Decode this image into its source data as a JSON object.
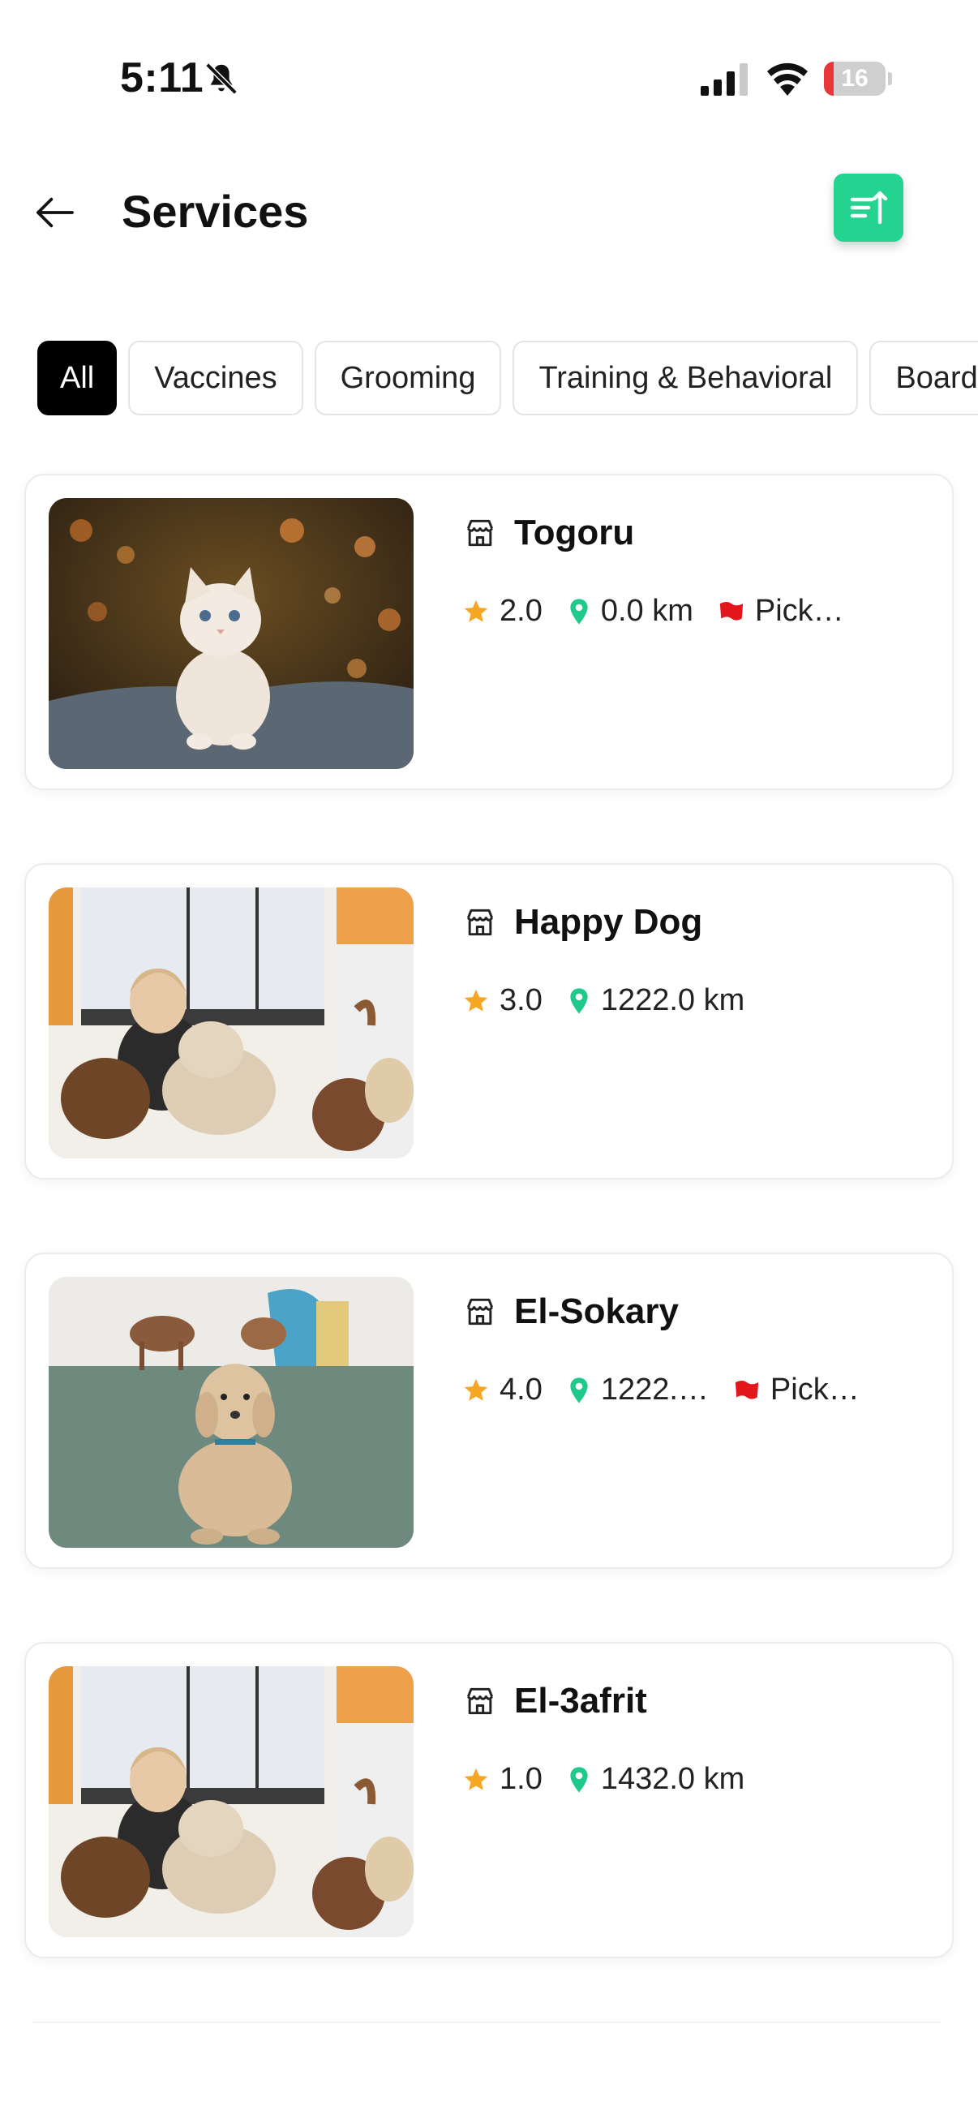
{
  "status_bar": {
    "time": "5:11",
    "battery": "16",
    "battery_level": 0.16
  },
  "header": {
    "title": "Services"
  },
  "filters": [
    {
      "label": "All",
      "active": true
    },
    {
      "label": "Vaccines",
      "active": false
    },
    {
      "label": "Grooming",
      "active": false
    },
    {
      "label": "Training & Behavioral",
      "active": false
    },
    {
      "label": "Boarding",
      "active": false
    }
  ],
  "services": [
    {
      "name": "Togoru",
      "rating": "2.0",
      "distance": "0.0 km",
      "tag": "Pick…",
      "image": "kitten-photo"
    },
    {
      "name": "Happy Dog",
      "rating": "3.0",
      "distance": "1222.0 km",
      "tag": "",
      "image": "daycare-photo"
    },
    {
      "name": "El-Sokary",
      "rating": "4.0",
      "distance": "1222.…",
      "tag": "Pick…",
      "image": "poodle-photo"
    },
    {
      "name": "El-3afrit",
      "rating": "1.0",
      "distance": "1432.0 km",
      "tag": "",
      "image": "daycare-photo"
    }
  ],
  "colors": {
    "accent": "#25d390",
    "star": "#f5a623",
    "pin": "#1ec98a",
    "flag": "#e3161c",
    "battery_low": "#e8363a"
  }
}
